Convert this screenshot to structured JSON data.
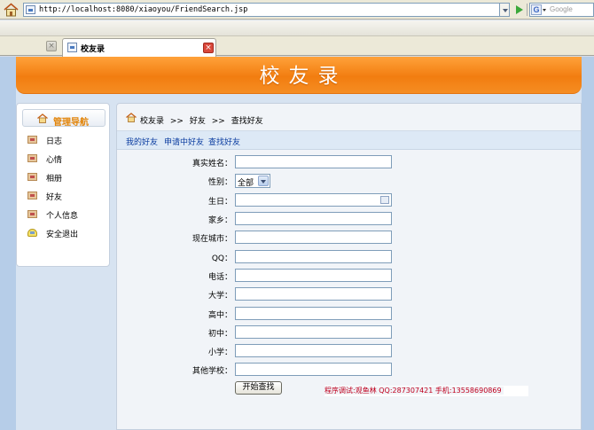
{
  "browser": {
    "url": "http://localhost:8080/xiaoyou/FriendSearch.jsp",
    "search_placeholder": "Google",
    "search_engine_logo": "G",
    "tab_title": "校友录",
    "tab_close": "×",
    "tab_back": "×"
  },
  "banner": {
    "title": "校友录"
  },
  "sidebar": {
    "header": "管理导航",
    "items": [
      {
        "label": "日志",
        "icon": "diary-icon"
      },
      {
        "label": "心情",
        "icon": "mood-icon"
      },
      {
        "label": "相册",
        "icon": "album-icon"
      },
      {
        "label": "好友",
        "icon": "friends-icon"
      },
      {
        "label": "个人信息",
        "icon": "profile-icon"
      },
      {
        "label": "安全退出",
        "icon": "logout-icon"
      }
    ]
  },
  "breadcrumb": {
    "home": "校友录",
    "sep1": ">>",
    "level1": "好友",
    "sep2": ">>",
    "current": "查找好友"
  },
  "subnav": [
    "我的好友",
    "申请中好友",
    "查找好友"
  ],
  "form": {
    "fields": [
      {
        "label": "真实姓名：",
        "value": ""
      },
      {
        "label": "性别：",
        "value": "全部"
      },
      {
        "label": "生日：",
        "value": ""
      },
      {
        "label": "家乡：",
        "value": ""
      },
      {
        "label": "现在城市：",
        "value": ""
      },
      {
        "label": "QQ：",
        "value": ""
      },
      {
        "label": "电话：",
        "value": ""
      },
      {
        "label": "大学：",
        "value": ""
      },
      {
        "label": "高中：",
        "value": ""
      },
      {
        "label": "初中：",
        "value": ""
      },
      {
        "label": "小学：",
        "value": ""
      },
      {
        "label": "其他学校：",
        "value": ""
      }
    ],
    "submit_label": "开始查找"
  },
  "footer": {
    "note": "程序调试:观鱼林 QQ:287307421 手机:13558690869"
  }
}
